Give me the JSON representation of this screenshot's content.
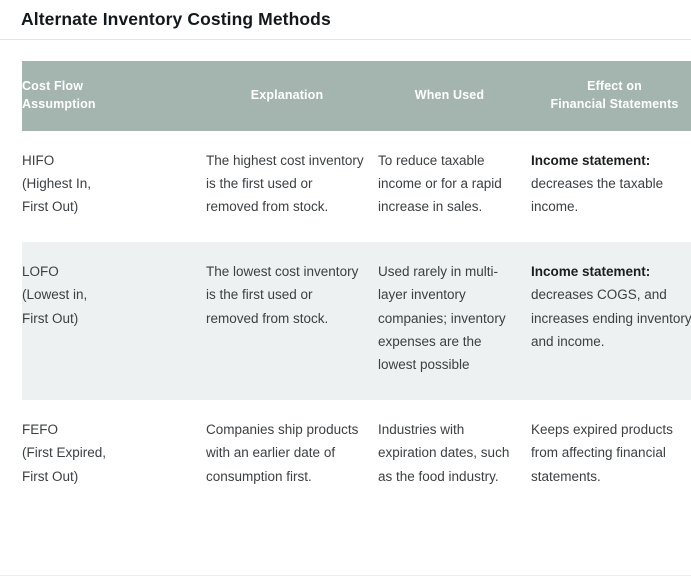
{
  "document": {
    "title": "Alternate Inventory Costing Methods"
  },
  "table": {
    "headers": [
      "Cost Flow\nAssumption",
      "Explanation",
      "When Used",
      "Effect on\nFinancial Statements"
    ],
    "header_background": "#a4b4af",
    "header_text_color": "#ffffff",
    "shaded_row_background": "#edf1f2",
    "rows": [
      {
        "shaded": false,
        "assumption": "HIFO\n(Highest In,\nFirst Out)",
        "explanation": "The highest cost inventory is the first used or removed from stock.",
        "when_used": "To reduce taxable income or for a rapid increase in sales.",
        "effect_lead": "Income statement:",
        "effect_rest": " decreases the taxable income."
      },
      {
        "shaded": true,
        "assumption": "LOFO\n(Lowest in,\nFirst Out)",
        "explanation": "The lowest cost inventory is the first used or removed from stock.",
        "when_used": "Used rarely in multi-layer inventory companies; inventory expenses are the lowest possible",
        "effect_lead": "Income statement:",
        "effect_rest": " decreases COGS, and increases ending inventory and income."
      },
      {
        "shaded": false,
        "assumption": "FEFO\n(First Expired,\nFirst Out)",
        "explanation": "Companies ship products with an earlier date of consumption first.",
        "when_used": "Industries with expiration dates, such as the food industry.",
        "effect_lead": "",
        "effect_rest": "Keeps expired products from affecting financial statements."
      }
    ]
  }
}
